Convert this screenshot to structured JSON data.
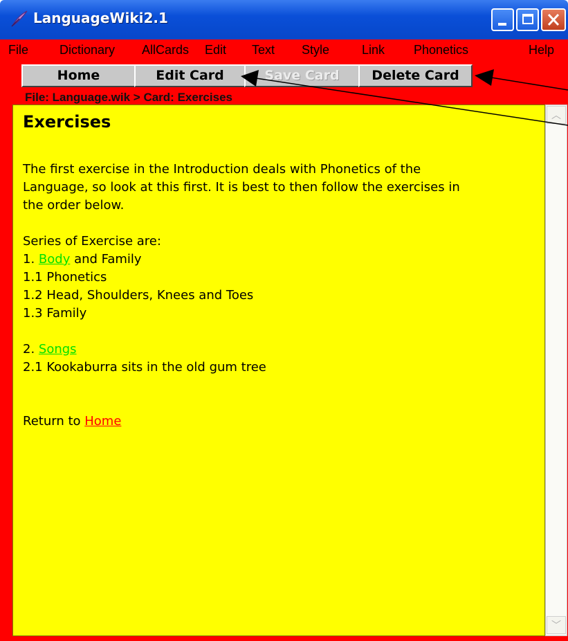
{
  "window": {
    "title": "LanguageWiki2.1"
  },
  "menu": [
    {
      "label": "File"
    },
    {
      "label": "Dictionary"
    },
    {
      "label": "AllCards"
    },
    {
      "label": "Edit"
    },
    {
      "label": "Text"
    },
    {
      "label": "Style"
    },
    {
      "label": "Link"
    },
    {
      "label": "Phonetics"
    },
    {
      "label": "Help"
    }
  ],
  "toolbar": {
    "home": "Home",
    "edit_card": "Edit Card",
    "save_card": "Save Card",
    "delete_card": "Delete Card"
  },
  "breadcrumb": "File: Language.wik > Card: Exercises",
  "card": {
    "title": "Exercises",
    "intro_1": "The first exercise in the Introduction deals with Phonetics of the",
    "intro_2": "Language, so look at this first. It is best to then follow the exercises in",
    "intro_3": "the order below.",
    "series_heading": "Series of Exercise are:",
    "item1_prefix": "1. ",
    "item1_link": "Body",
    "item1_suffix": " and Family",
    "item1_1": "1.1 Phonetics",
    "item1_2": "1.2 Head, Shoulders, Knees and Toes",
    "item1_3": "1.3 Family",
    "item2_prefix": "2. ",
    "item2_link": "Songs",
    "item2_1": "2.1 Kookaburra sits in the old gum tree",
    "return_prefix": "Return to ",
    "return_link": "Home"
  },
  "colors": {
    "background": "#ffff00",
    "frame": "#ff0000",
    "link_green": "#00e000",
    "link_red": "#ff0000"
  }
}
